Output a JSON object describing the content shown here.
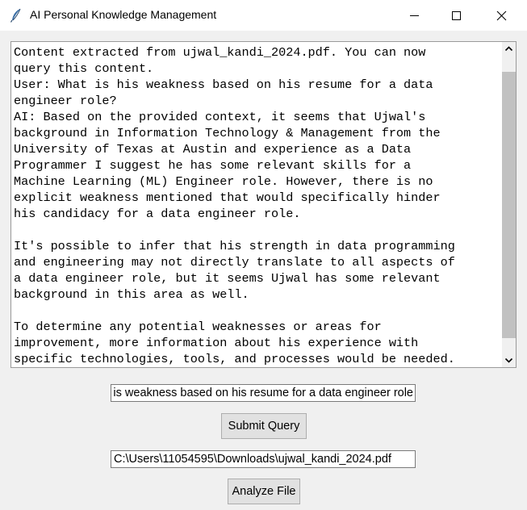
{
  "window": {
    "title": "AI Personal Knowledge Management"
  },
  "icons": {
    "app": "feather-icon",
    "minimize": "minimize-icon",
    "maximize": "maximize-icon",
    "close": "close-icon",
    "scroll_up": "scroll-up-arrow-icon",
    "scroll_down": "scroll-down-arrow-icon"
  },
  "output": {
    "text": "Content extracted from ujwal_kandi_2024.pdf. You can now\nquery this content.\nUser: What is his weakness based on his resume for a data\nengineer role?\nAI: Based on the provided context, it seems that Ujwal's\nbackground in Information Technology & Management from the\nUniversity of Texas at Austin and experience as a Data\nProgrammer I suggest he has some relevant skills for a\nMachine Learning (ML) Engineer role. However, there is no\nexplicit weakness mentioned that would specifically hinder\nhis candidacy for a data engineer role.\n\nIt's possible to infer that his strength in data programming\nand engineering may not directly translate to all aspects of\na data engineer role, but it seems Ujwal has some relevant\nbackground in this area as well.\n\nTo determine any potential weaknesses or areas for\nimprovement, more information about his experience with\nspecific technologies, tools, and processes would be needed."
  },
  "query": {
    "value": "What is his weakness based on his resume for a data engineer role?"
  },
  "buttons": {
    "submit": "Submit Query",
    "analyze": "Analyze File"
  },
  "file": {
    "path": "C:\\Users\\11054595\\Downloads\\ujwal_kandi_2024.pdf"
  },
  "colors": {
    "window_bg": "#f0f0f0",
    "titlebar_bg": "#ffffff",
    "scroll_thumb": "#c1c1c1",
    "button_bg": "#e1e1e1"
  }
}
